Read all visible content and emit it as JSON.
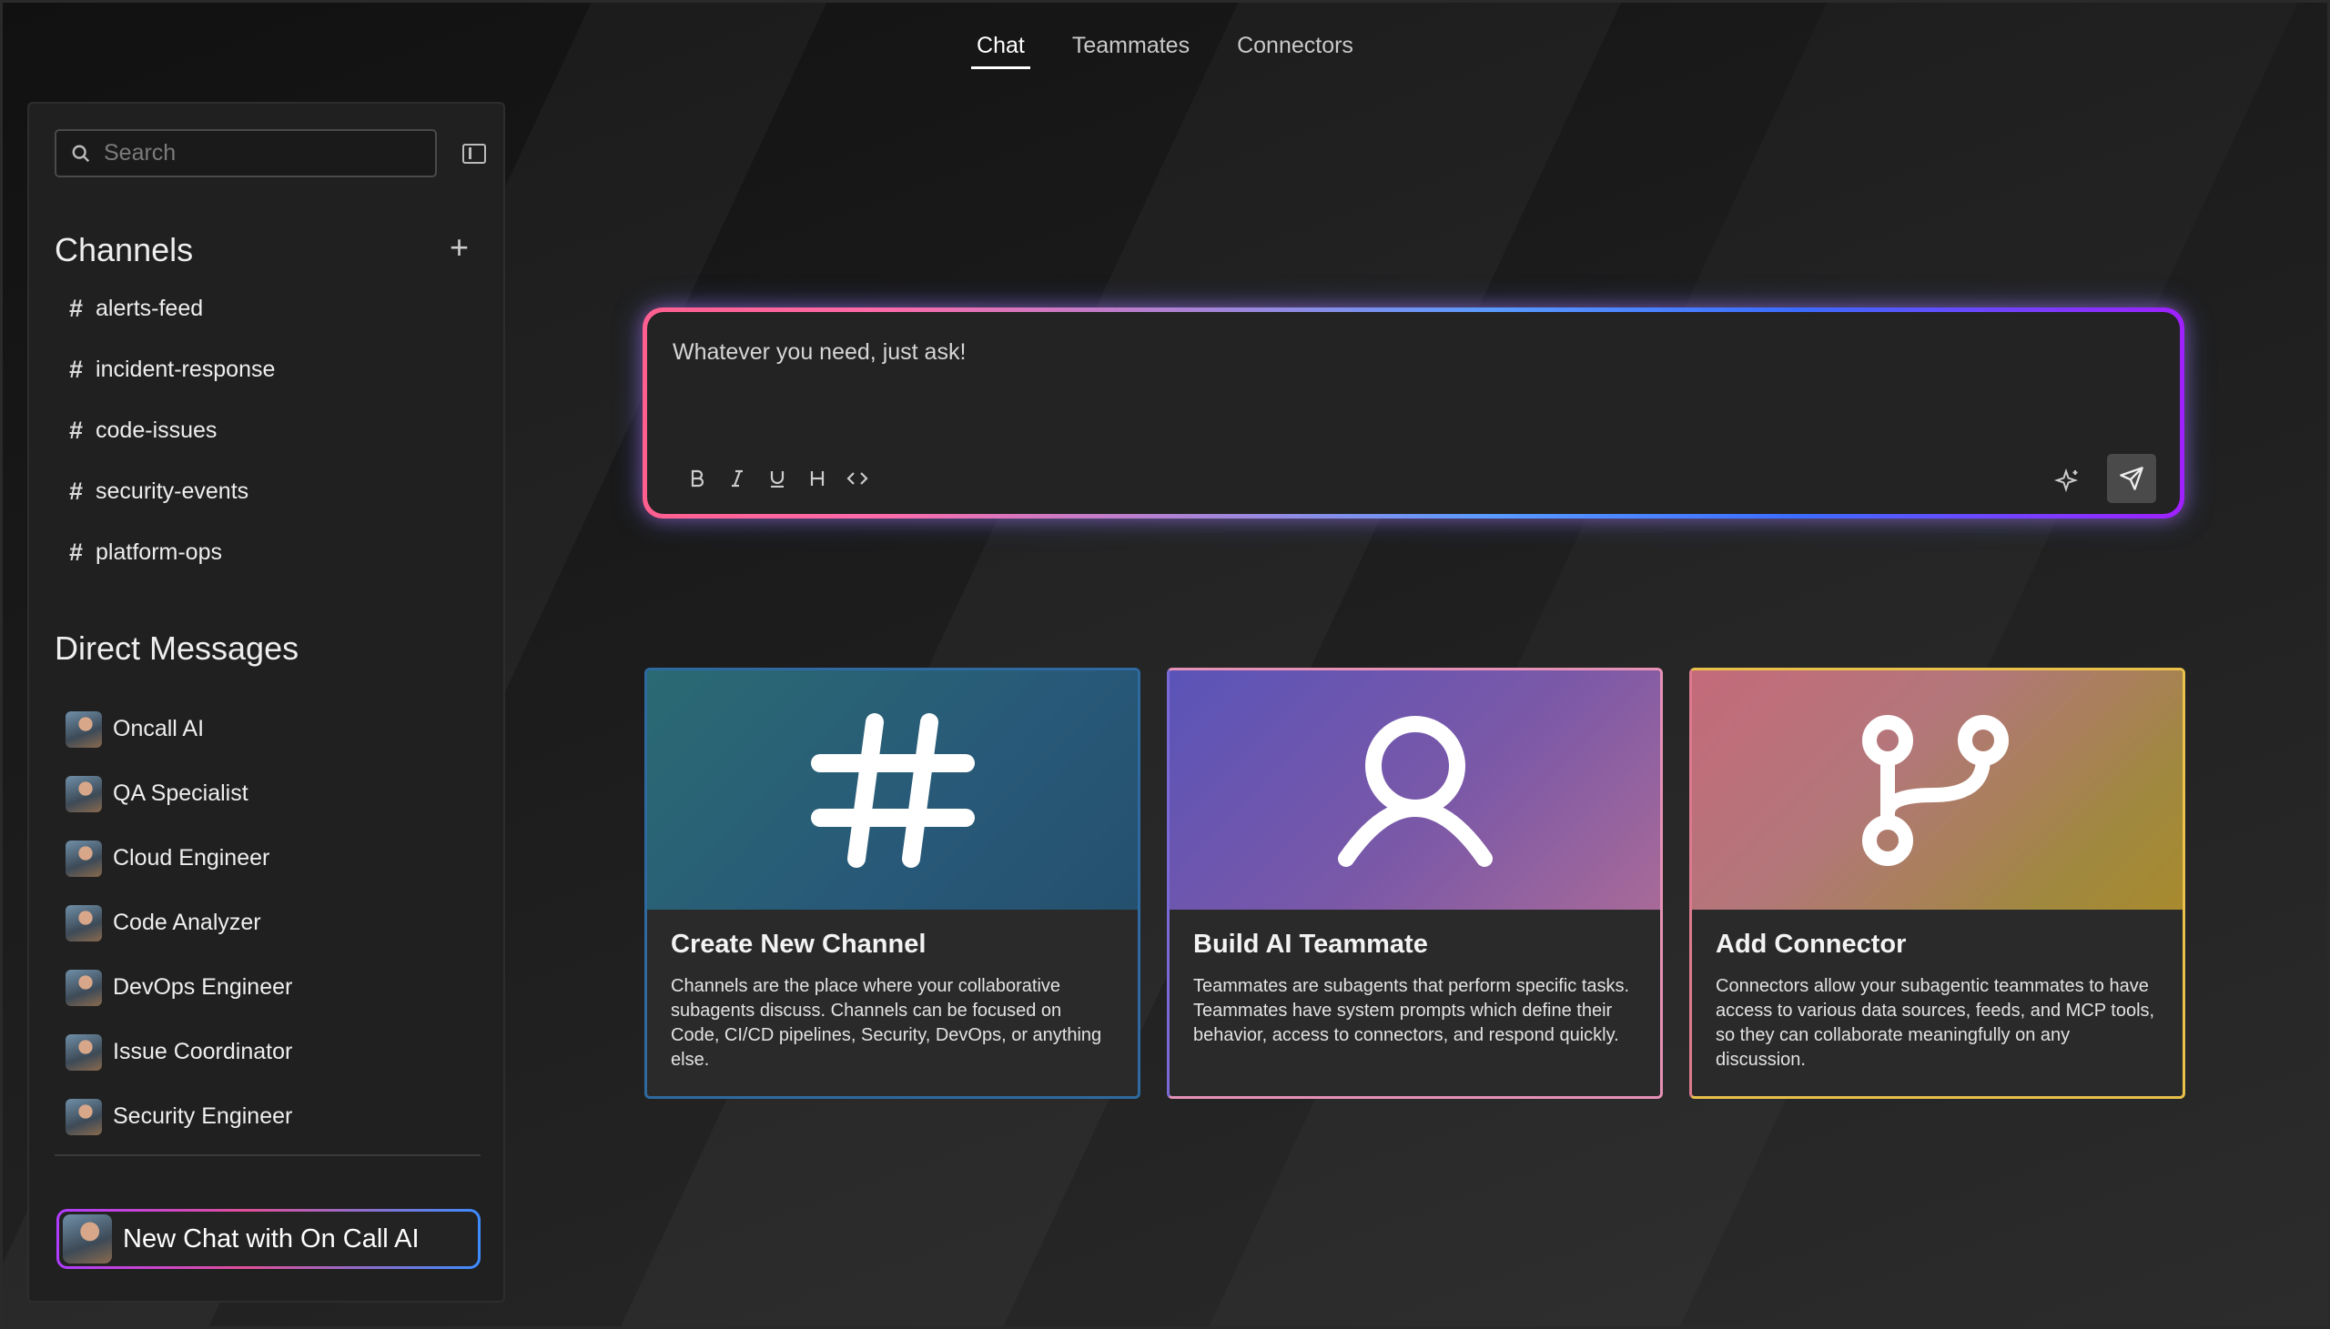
{
  "nav": {
    "tabs": [
      {
        "label": "Chat",
        "active": true
      },
      {
        "label": "Teammates",
        "active": false
      },
      {
        "label": "Connectors",
        "active": false
      }
    ]
  },
  "sidebar": {
    "search_placeholder": "Search",
    "channels_title": "Channels",
    "channels": [
      {
        "label": "alerts-feed"
      },
      {
        "label": "incident-response"
      },
      {
        "label": "code-issues"
      },
      {
        "label": "security-events"
      },
      {
        "label": "platform-ops"
      }
    ],
    "dm_title": "Direct Messages",
    "dms": [
      {
        "label": "Oncall AI"
      },
      {
        "label": "QA Specialist"
      },
      {
        "label": "Cloud Engineer"
      },
      {
        "label": "Code Analyzer"
      },
      {
        "label": "DevOps Engineer"
      },
      {
        "label": "Issue Coordinator"
      },
      {
        "label": "Security Engineer"
      }
    ],
    "new_chat_label": "New Chat with On Call AI"
  },
  "composer": {
    "placeholder": "Whatever you need, just ask!",
    "format_buttons": [
      "B",
      "I",
      "U",
      "H",
      "<>"
    ],
    "icons": [
      "sparkle-icon",
      "send-icon"
    ]
  },
  "cards": [
    {
      "title": "Create New Channel",
      "description": "Channels are the place where your collaborative subagents discuss. Channels can be focused on Code, CI/CD pipelines, Security, DevOps, or anything else.",
      "icon": "hash-icon"
    },
    {
      "title": "Build AI Teammate",
      "description": "Teammates are subagents that perform specific tasks. Teammates have system prompts which define their behavior, access to connectors, and respond quickly.",
      "icon": "user-icon"
    },
    {
      "title": "Add Connector",
      "description": "Connectors allow your subagentic teammates to have access to various data sources, feeds, and MCP tools, so they can collaborate meaningfully on any discussion.",
      "icon": "git-branch-icon"
    }
  ],
  "colors": {
    "background": "#1a1a1a",
    "panel": "#202020",
    "card_teal": "#285978",
    "card_purple": "#7a58a8",
    "card_gold": "#a0883e"
  }
}
